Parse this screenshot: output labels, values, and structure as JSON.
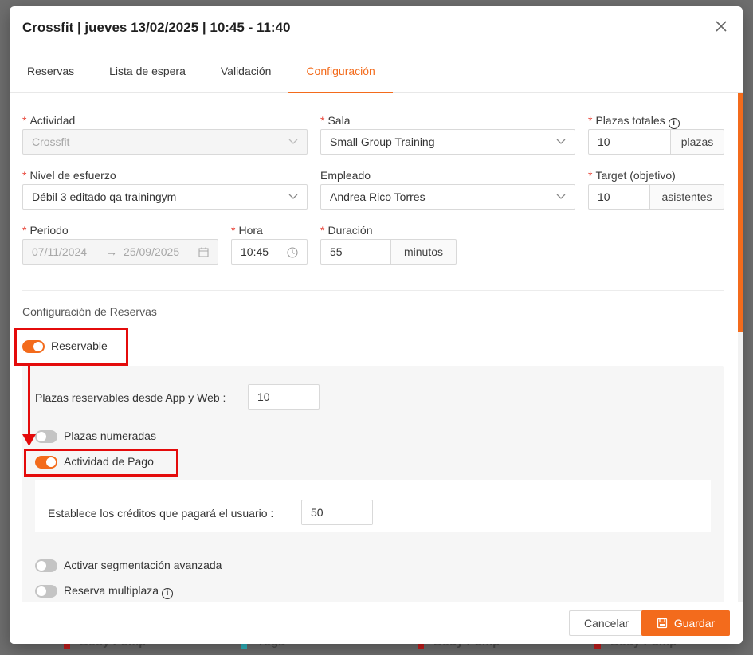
{
  "modal": {
    "title": "Crossfit | jueves 13/02/2025 | 10:45 - 11:40"
  },
  "tabs": [
    {
      "label": "Reservas"
    },
    {
      "label": "Lista de espera"
    },
    {
      "label": "Validación"
    },
    {
      "label": "Configuración",
      "active": true
    }
  ],
  "form": {
    "actividad": {
      "label": "Actividad",
      "value": "Crossfit",
      "required": true,
      "disabled": true
    },
    "sala": {
      "label": "Sala",
      "value": "Small Group Training",
      "required": true
    },
    "plazas_totales": {
      "label": "Plazas totales",
      "value": "10",
      "addon": "plazas",
      "required": true
    },
    "nivel": {
      "label": "Nivel de esfuerzo",
      "value": "Débil 3 editado qa trainingym",
      "required": true
    },
    "empleado": {
      "label": "Empleado",
      "value": "Andrea Rico Torres"
    },
    "target": {
      "label": "Target (objetivo)",
      "value": "10",
      "addon": "asistentes",
      "required": true
    },
    "periodo": {
      "label": "Periodo",
      "start": "07/11/2024",
      "separator": "→",
      "end": "25/09/2025",
      "required": true
    },
    "hora": {
      "label": "Hora",
      "value": "10:45",
      "required": true
    },
    "duracion": {
      "label": "Duración",
      "value": "55",
      "addon": "minutos",
      "required": true
    },
    "required_mark": "*"
  },
  "reservas_config": {
    "section_title": "Configuración de Reservas",
    "reservable": {
      "label": "Reservable",
      "on": true
    },
    "plazas_reservables": {
      "label": "Plazas reservables desde App y Web",
      "colon": ":",
      "value": "10"
    },
    "plazas_numeradas": {
      "label": "Plazas numeradas",
      "on": false
    },
    "actividad_pago": {
      "label": "Actividad de Pago",
      "on": true
    },
    "creditos": {
      "label": "Establece los créditos que pagará el usuario",
      "colon": ":",
      "value": "50"
    },
    "segmentacion": {
      "label": "Activar segmentación avanzada",
      "on": false
    },
    "multiplaza": {
      "label": "Reserva multiplaza",
      "on": false
    }
  },
  "footer": {
    "cancel_label": "Cancelar",
    "save_label": "Guardar"
  },
  "colors": {
    "accent": "#f36b1c",
    "highlight": "#e40b0b",
    "required": "#e8463a"
  },
  "background": {
    "cards": [
      "Body Pump",
      "Yoga",
      "Body Pump",
      "Body Pump"
    ]
  }
}
